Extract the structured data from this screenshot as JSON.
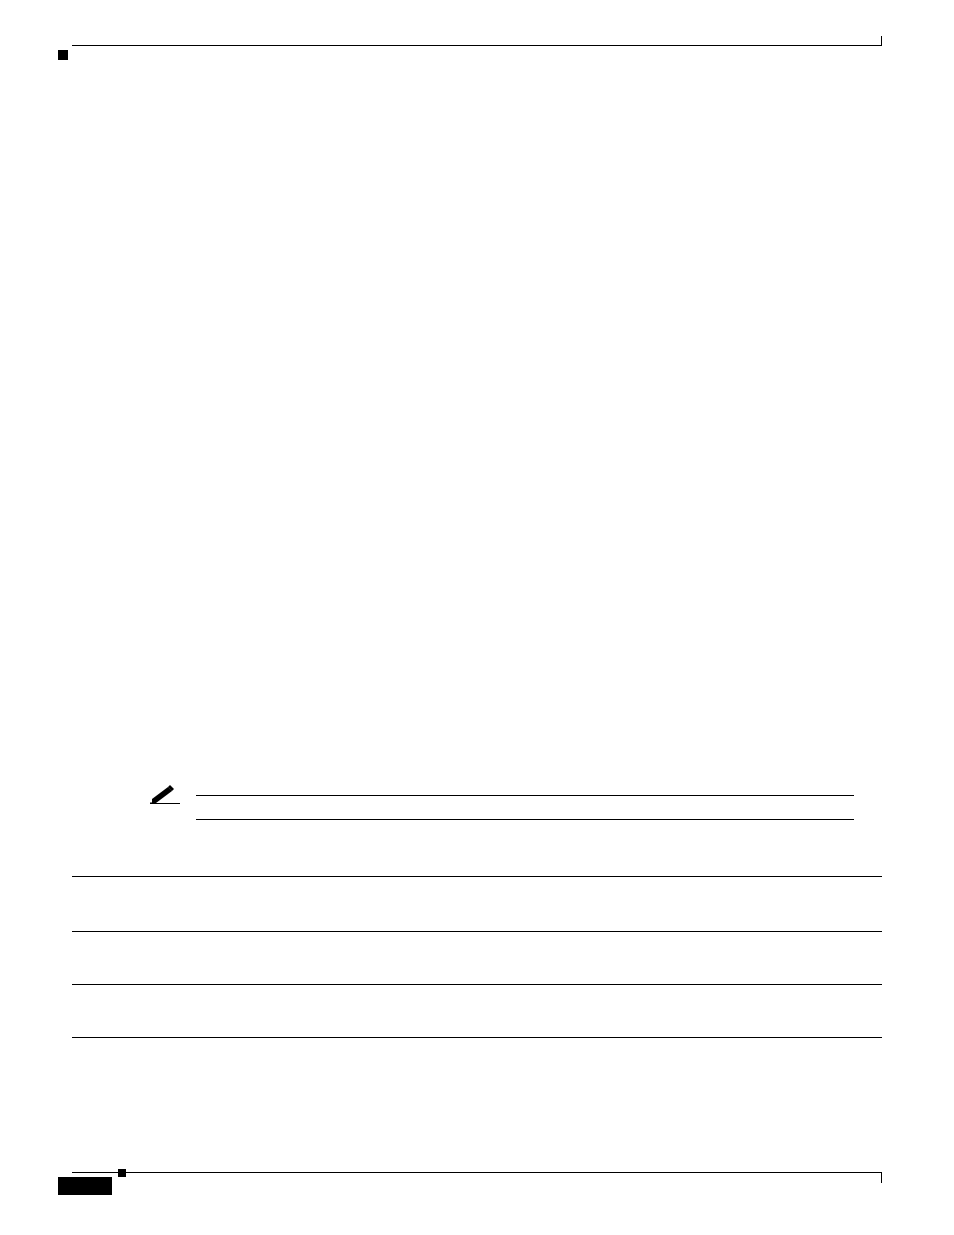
{
  "page": {
    "note_label": "",
    "note_text": ""
  },
  "table": {
    "header_group": "",
    "columns": [
      "",
      "",
      "",
      "",
      "",
      "",
      "",
      "",
      "",
      ""
    ],
    "rows": [
      [
        "",
        "",
        "",
        "",
        "",
        "",
        "",
        "",
        "",
        ""
      ],
      [
        "",
        "",
        "",
        "",
        "",
        "",
        "",
        "",
        "",
        ""
      ]
    ]
  }
}
